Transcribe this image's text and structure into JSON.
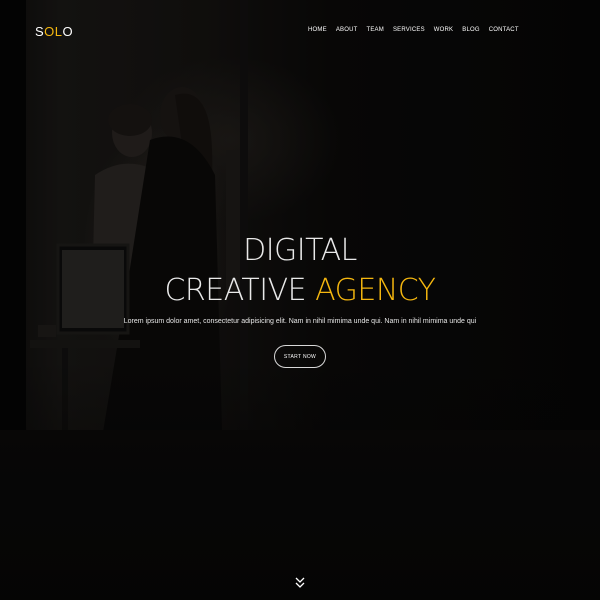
{
  "brand": {
    "logo_left": "S",
    "logo_accent": "OL",
    "logo_right": "O",
    "accent_color": "#f5b70f"
  },
  "nav": {
    "items": [
      "HOME",
      "ABOUT",
      "TEAM",
      "SERVICES",
      "WORK",
      "BLOG",
      "CONTACT"
    ]
  },
  "hero": {
    "headline_line1": "DIGITAL",
    "headline_line2_prefix": "CREATIVE ",
    "headline_line2_accent": "AGENCY",
    "subtitle": "Lorem ipsum dolor amet, consectetur adipisicing elit. Nam in nihil mimima unde qui. Nam in nihil mimima unde qui",
    "cta_label": "START NOW",
    "scroll_icon": "chevron-down-double-icon"
  }
}
